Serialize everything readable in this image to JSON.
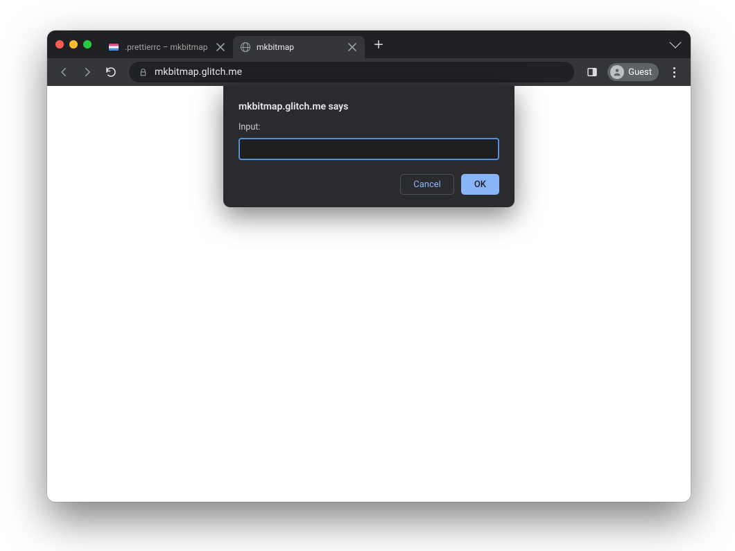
{
  "tabs": [
    {
      "title": ".prettierrc – mkbitmap",
      "active": false
    },
    {
      "title": "mkbitmap",
      "active": true
    }
  ],
  "toolbar": {
    "url": "mkbitmap.glitch.me",
    "profile_label": "Guest"
  },
  "dialog": {
    "title": "mkbitmap.glitch.me says",
    "label": "Input:",
    "input_value": "",
    "cancel_label": "Cancel",
    "ok_label": "OK"
  }
}
